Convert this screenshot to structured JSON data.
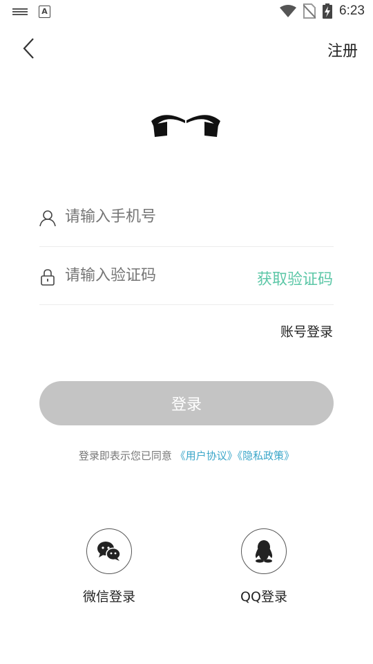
{
  "status_bar": {
    "time": "6:23"
  },
  "header": {
    "register_label": "注册"
  },
  "form": {
    "phone_placeholder": "请输入手机号",
    "code_placeholder": "请输入验证码",
    "get_code_label": "获取验证码",
    "account_login_label": "账号登录",
    "login_button_label": "登录"
  },
  "agreement": {
    "prefix": "登录即表示您已同意",
    "user_agreement": "《用户协议》",
    "privacy_policy": "《隐私政策》"
  },
  "social": [
    {
      "label": "微信登录",
      "icon": "wechat-icon"
    },
    {
      "label": "QQ登录",
      "icon": "qq-icon"
    }
  ],
  "colors": {
    "accent": "#5cc7a7",
    "link": "#3aa6c9",
    "button_disabled": "#c4c4c4"
  }
}
